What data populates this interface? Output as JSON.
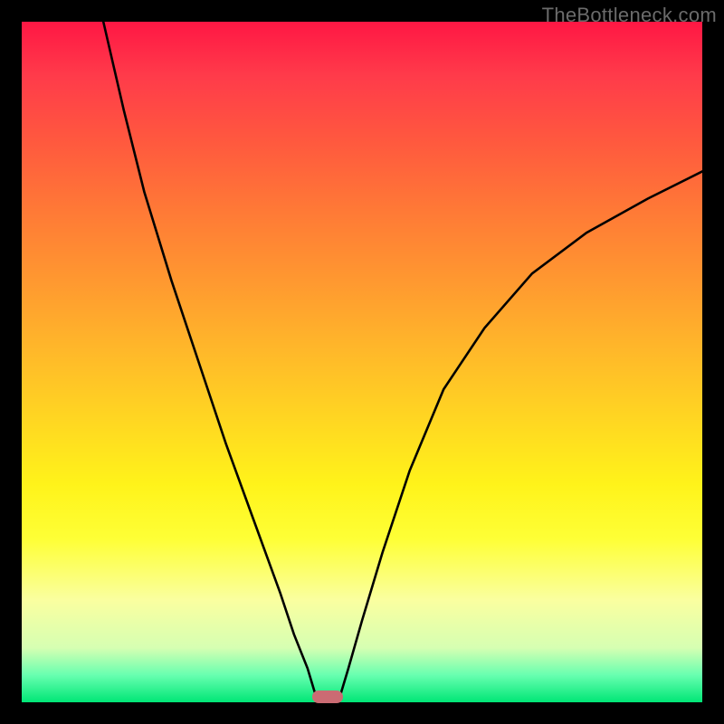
{
  "watermark": "TheBottleneck.com",
  "chart_data": {
    "type": "line",
    "xlim": [
      0,
      100
    ],
    "ylim": [
      0,
      100
    ],
    "series": [
      {
        "name": "left-branch",
        "x": [
          12,
          15,
          18,
          22,
          26,
          30,
          34,
          38,
          40,
          42,
          43.5
        ],
        "y": [
          100,
          87,
          75,
          62,
          50,
          38,
          27,
          16,
          10,
          5,
          0
        ]
      },
      {
        "name": "right-branch",
        "x": [
          46.5,
          48,
          50,
          53,
          57,
          62,
          68,
          75,
          83,
          92,
          100
        ],
        "y": [
          0,
          5,
          12,
          22,
          34,
          46,
          55,
          63,
          69,
          74,
          78
        ]
      }
    ],
    "marker": {
      "x": 45,
      "y": 0,
      "color": "#cb6b73"
    },
    "gradient_stops": [
      {
        "pct": 0,
        "color": "#ff1744"
      },
      {
        "pct": 50,
        "color": "#ffd522"
      },
      {
        "pct": 80,
        "color": "#feff36"
      },
      {
        "pct": 100,
        "color": "#00e676"
      }
    ]
  }
}
